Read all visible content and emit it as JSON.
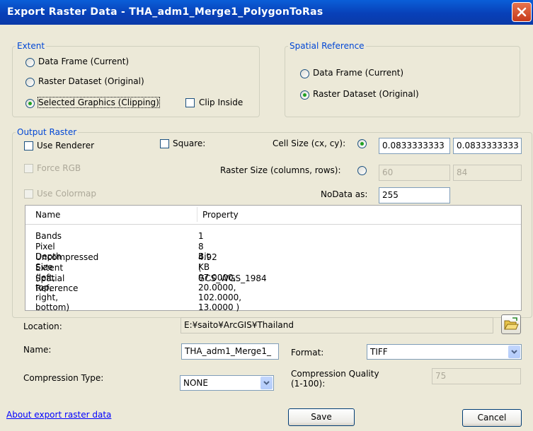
{
  "window": {
    "title": "Export Raster Data - THA_adm1_Merge1_PolygonToRas"
  },
  "extent": {
    "legend": "Extent",
    "options": [
      {
        "label": "Data Frame (Current)",
        "checked": false
      },
      {
        "label": "Raster Dataset (Original)",
        "checked": false
      },
      {
        "label": "Selected Graphics (Clipping)",
        "checked": true
      }
    ],
    "clip_inside_label": "Clip Inside"
  },
  "spatial_reference": {
    "legend": "Spatial Reference",
    "options": [
      {
        "label": "Data Frame (Current)",
        "checked": false
      },
      {
        "label": "Raster Dataset (Original)",
        "checked": true
      }
    ]
  },
  "output_raster": {
    "legend": "Output Raster",
    "use_renderer_label": "Use Renderer",
    "square_label": "Square:",
    "force_rgb_label": "Force RGB",
    "use_colormap_label": "Use Colormap",
    "cell_size_label": "Cell Size (cx, cy):",
    "cell_size_x": "0.0833333333",
    "cell_size_y": "0.0833333333",
    "raster_size_label": "Raster Size (columns, rows):",
    "raster_columns": "60",
    "raster_rows": "84",
    "nodata_label": "NoData as:",
    "nodata_value": "255"
  },
  "properties": {
    "headers": [
      "Name",
      "Property"
    ],
    "rows": [
      [
        "Bands",
        "1"
      ],
      [
        "Pixel Depth",
        "8 Bit"
      ],
      [
        "Uncompressed Size",
        "4.92 KB"
      ],
      [
        "Extent (left, top, right, bottom)",
        "( 97.0000, 20.0000, 102.0000, 13.0000 )"
      ],
      [
        "Spatial Reference",
        "GCS_WGS_1984"
      ]
    ]
  },
  "location": {
    "label": "Location:",
    "value": "E:¥saito¥ArcGIS¥Thailand"
  },
  "name": {
    "label": "Name:",
    "value": "THA_adm1_Merge1_"
  },
  "format": {
    "label": "Format:",
    "value": "TIFF"
  },
  "compression_type": {
    "label": "Compression Type:",
    "value": "NONE"
  },
  "compression_quality": {
    "label_line1": "Compression Quality",
    "label_line2": "(1-100):",
    "value": "75"
  },
  "footer": {
    "about_link": "About export raster data",
    "save_label": "Save",
    "cancel_label": "Cancel"
  },
  "icons": {
    "close": "close-icon",
    "folder": "folder-open-icon",
    "dropdown": "chevron-down-icon"
  },
  "colors": {
    "title_bar": "#0a48c8",
    "legend": "#0046d5",
    "link": "#0000ff"
  }
}
